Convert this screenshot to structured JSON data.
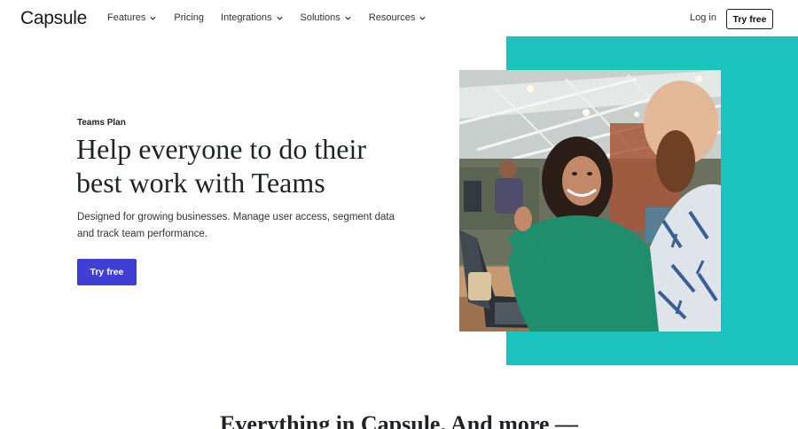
{
  "brand": {
    "name": "Capsule"
  },
  "nav": {
    "items": [
      {
        "label": "Features",
        "has_dropdown": true
      },
      {
        "label": "Pricing",
        "has_dropdown": false
      },
      {
        "label": "Integrations",
        "has_dropdown": true
      },
      {
        "label": "Solutions",
        "has_dropdown": true
      },
      {
        "label": "Resources",
        "has_dropdown": true
      }
    ],
    "login_label": "Log in",
    "try_free_label": "Try free"
  },
  "hero": {
    "eyebrow": "Teams Plan",
    "headline": "Help everyone to do their best work with Teams",
    "description": "Designed for growing businesses. Manage user access, segment data and track team performance.",
    "cta_label": "Try free",
    "accent_color": "#1cc2be",
    "cta_color": "#3f3fd6"
  },
  "section": {
    "title": "Everything in Capsule. And more —"
  }
}
